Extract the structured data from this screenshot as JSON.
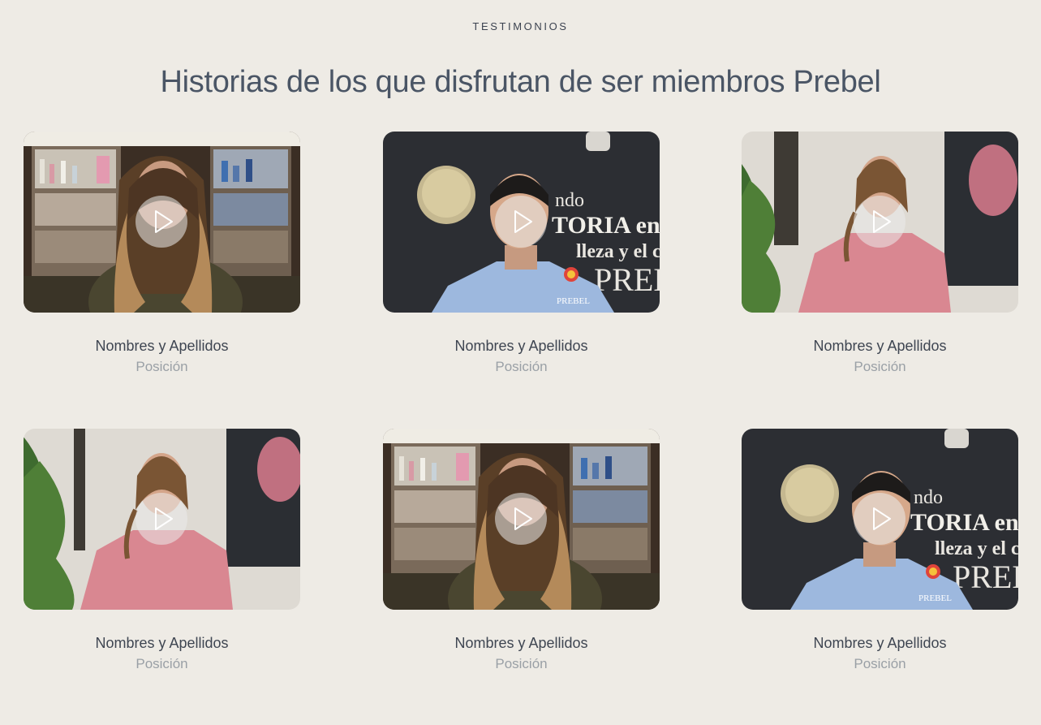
{
  "section": {
    "eyebrow": "TESTIMONIOS",
    "headline": "Historias de los que disfrutan de ser miembros Prebel"
  },
  "testimonials": [
    {
      "name": "Nombres y Apellidos",
      "role": "Posición",
      "scene": "store-shelves",
      "play_icon": "play-icon"
    },
    {
      "name": "Nombres y Apellidos",
      "role": "Posición",
      "scene": "brand-wall",
      "play_icon": "play-icon"
    },
    {
      "name": "Nombres y Apellidos",
      "role": "Posición",
      "scene": "office-plant",
      "play_icon": "play-icon"
    },
    {
      "name": "Nombres y Apellidos",
      "role": "Posición",
      "scene": "office-plant",
      "play_icon": "play-icon"
    },
    {
      "name": "Nombres y Apellidos",
      "role": "Posición",
      "scene": "store-shelves",
      "play_icon": "play-icon"
    },
    {
      "name": "Nombres y Apellidos",
      "role": "Posición",
      "scene": "brand-wall",
      "play_icon": "play-icon"
    }
  ],
  "brand_wall_text": {
    "line1": "ndo",
    "line2": "TORIA en e",
    "line3": "lleza y el cu",
    "line4": "PREB",
    "badge": "PREBEL"
  },
  "colors": {
    "background": "#eeebe5",
    "heading": "#4a5565",
    "name": "#3f4652",
    "role": "#9aa0a6"
  }
}
